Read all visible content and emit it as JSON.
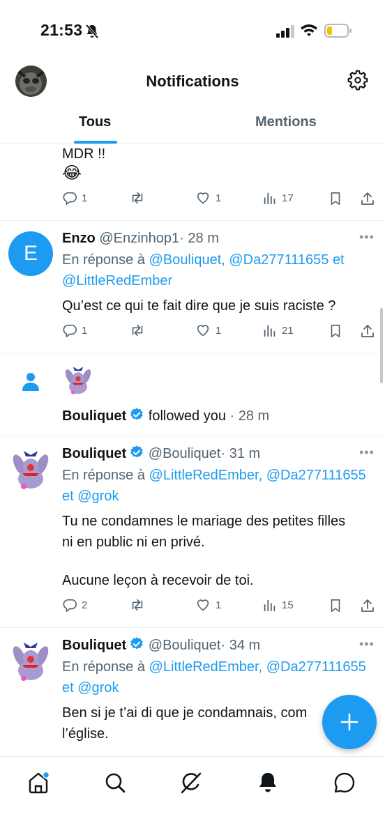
{
  "status_bar": {
    "time": "21:53"
  },
  "header": {
    "title": "Notifications"
  },
  "tabs": [
    {
      "label": "Tous"
    },
    {
      "label": "Mentions"
    }
  ],
  "items": [
    {
      "text_lines": [
        "MDR !!",
        "😂"
      ],
      "stats": {
        "replies": "1",
        "reposts": "",
        "likes": "1",
        "views": "17"
      }
    },
    {
      "avatar_letter": "E",
      "name": "Enzo",
      "handle": "@Enzinhop1",
      "time": "· 28 m",
      "reply_prefix": "En réponse à",
      "reply_to_1": "@Bouliquet, @Da277111655",
      "reply_joiner": "et",
      "reply_to_2": "@LittleRedEmber",
      "text": "Qu’est ce qui te fait dire que je suis raciste ?",
      "stats": {
        "replies": "1",
        "reposts": "",
        "likes": "1",
        "views": "21"
      }
    },
    {
      "name": "Bouliquet",
      "action": "followed you",
      "time": "· 28 m"
    },
    {
      "name": "Bouliquet",
      "handle": "@Bouliquet",
      "time": "· 31 m",
      "reply_prefix": "En réponse à",
      "reply_to_1": "@LittleRedEmber,",
      "reply_to_2": "@Da277111655",
      "reply_joiner": "et",
      "reply_to_3": "@grok",
      "text_lines": [
        "Tu ne condamnes le mariage des petites filles",
        "ni en public ni en privé.",
        "",
        "Aucune leçon à recevoir de toi."
      ],
      "stats": {
        "replies": "2",
        "reposts": "",
        "likes": "1",
        "views": "15"
      }
    },
    {
      "name": "Bouliquet",
      "handle": "@Bouliquet",
      "time": "· 34 m",
      "reply_prefix": "En réponse à",
      "reply_to_1": "@LittleRedEmber,",
      "reply_to_2": "@Da277111655",
      "reply_joiner": "et",
      "reply_to_3": "@grok",
      "text_lines": [
        "Ben si je t’ai di que je condamnais, com",
        "l’église."
      ]
    }
  ],
  "colors": {
    "accent": "#1d9bf0",
    "text": "#0f1419",
    "muted": "#536471"
  },
  "icons": {
    "bottom_nav": [
      "home-icon",
      "search-icon",
      "grok-icon",
      "notifications-icon",
      "messages-icon"
    ],
    "fab": "compose-plus-icon"
  }
}
